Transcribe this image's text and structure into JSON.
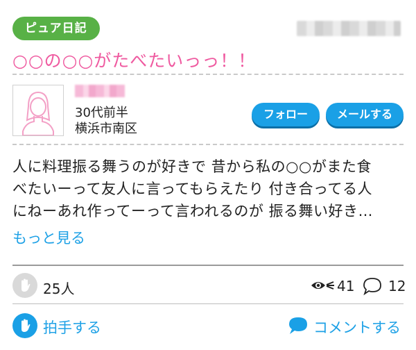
{
  "post": {
    "badge": "ピュア日記",
    "title": "○○の○○がたべたいっっ！！",
    "body_lines": [
      "人に料理振る舞うのが好きで 昔から私の○○がまた食",
      "べたいーって友人に言ってもらえたり 付き合ってる人",
      "にねーあれ作ってーって言われるのが 振る舞い好き…"
    ],
    "more_label": "もっと見る"
  },
  "profile": {
    "age": "30代前半",
    "location": "横浜市南区",
    "follow_label": "フォロー",
    "mail_label": "メールする",
    "avatar_icon": "user-silhouette-icon"
  },
  "stats": {
    "claps": "25人",
    "views": "41",
    "comments": "12"
  },
  "actions": {
    "clap_label": "拍手する",
    "comment_label": "コメントする"
  },
  "colors": {
    "badge_green": "#58b146",
    "title_pink": "#ef5aa0",
    "accent_blue": "#1aa0e6",
    "link_blue": "#1ea1e6"
  }
}
